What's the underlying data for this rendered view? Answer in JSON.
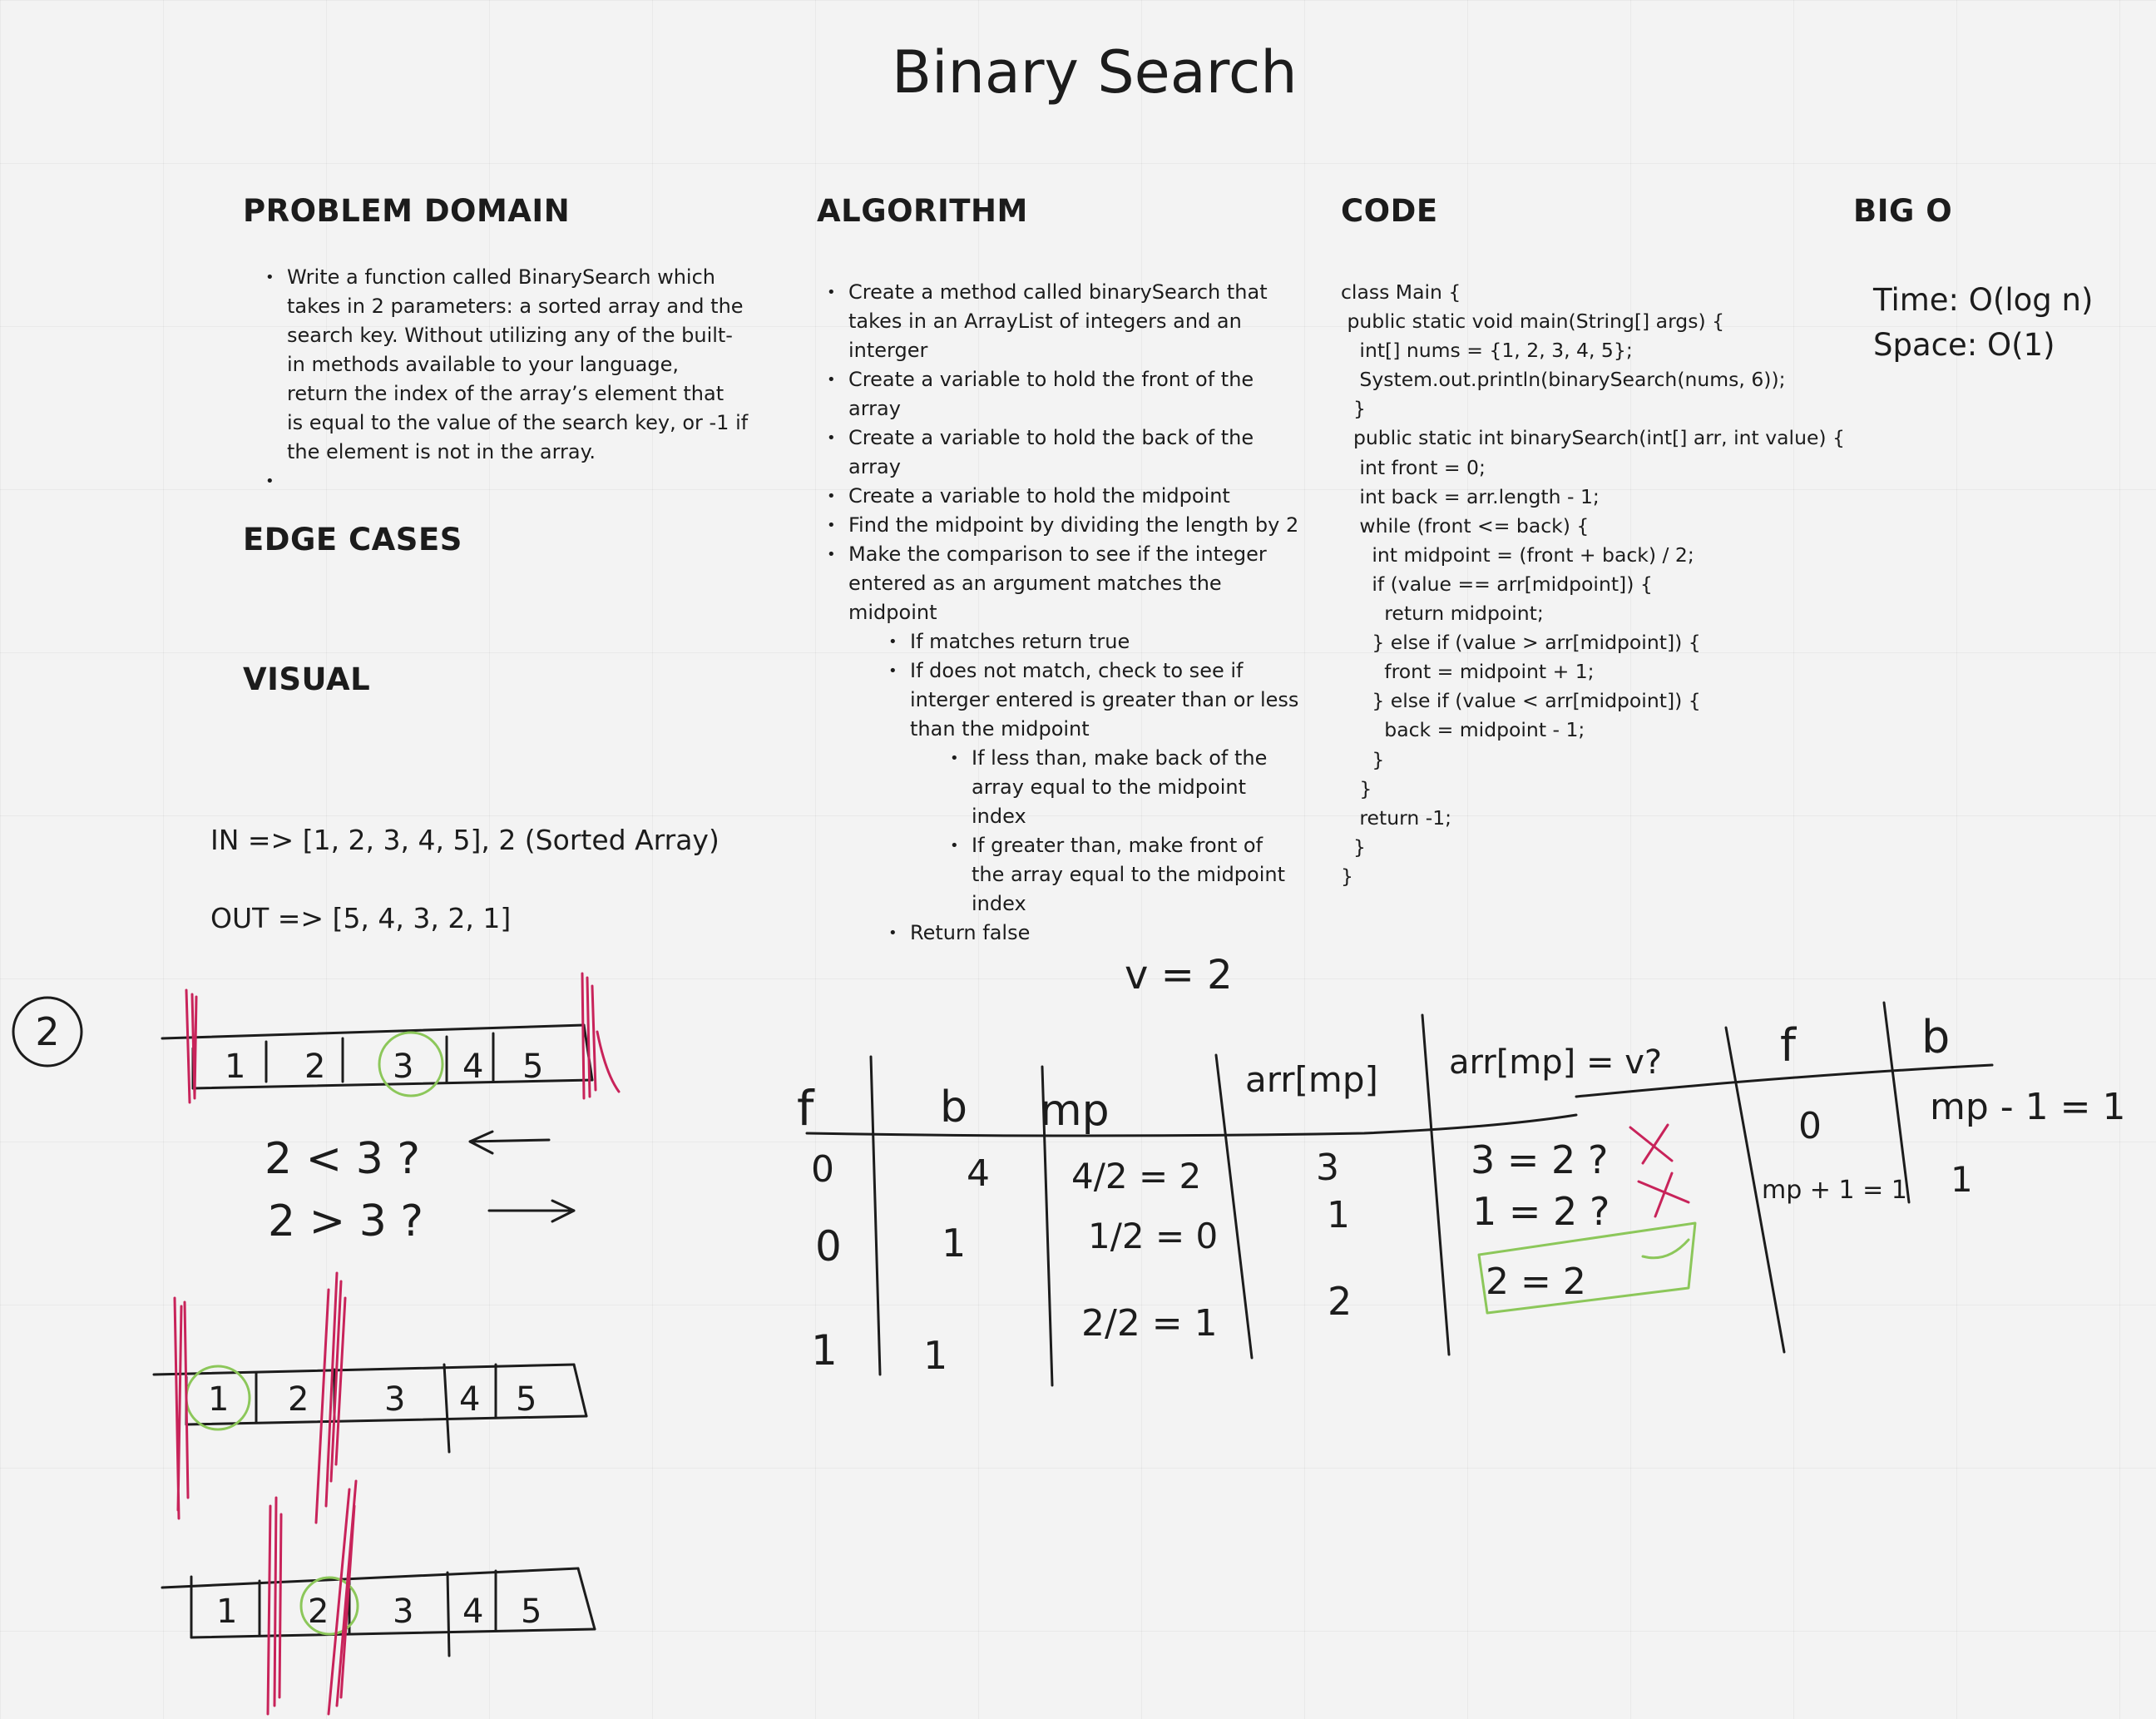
{
  "title": "Binary Search",
  "problem_domain": {
    "heading": "PROBLEM DOMAIN",
    "lines": [
      "Write a function called BinarySearch which",
      "takes in 2 parameters: a sorted array and the",
      "search key. Without utilizing any of the built-",
      "in methods available to your language,",
      "return the index of the array’s element that",
      "is equal to the value of the search key, or -1 if",
      "the element is not in the array."
    ],
    "empty_bullet": ""
  },
  "edge_cases": {
    "heading": "EDGE CASES"
  },
  "visual": {
    "heading": "VISUAL",
    "input": "IN => [1, 2, 3, 4, 5], 2 (Sorted Array)",
    "output": "OUT => [5, 4, 3, 2, 1]"
  },
  "algorithm": {
    "heading": "ALGORITHM",
    "items": [
      {
        "level": 0,
        "lines": [
          "Create a method called binarySearch that",
          "takes in an ArrayList of integers and an",
          "interger"
        ]
      },
      {
        "level": 0,
        "lines": [
          "Create a variable to hold the front of the",
          "array"
        ]
      },
      {
        "level": 0,
        "lines": [
          "Create a variable to hold the back of the",
          "array"
        ]
      },
      {
        "level": 0,
        "lines": [
          "Create a variable to hold the midpoint"
        ]
      },
      {
        "level": 0,
        "lines": [
          "Find the midpoint by dividing the length by 2"
        ]
      },
      {
        "level": 0,
        "lines": [
          "Make the comparison to see if the integer",
          "entered as an argument matches the",
          "midpoint"
        ]
      },
      {
        "level": 1,
        "lines": [
          "If matches return true"
        ]
      },
      {
        "level": 1,
        "lines": [
          "If does not match, check to see if",
          "interger entered is greater than or less",
          "than the midpoint"
        ]
      },
      {
        "level": 2,
        "lines": [
          "If less than, make back of the",
          "array equal to the midpoint",
          "index"
        ]
      },
      {
        "level": 2,
        "lines": [
          "If greater than, make front of",
          "the array equal to the midpoint",
          "index"
        ]
      },
      {
        "level": 1,
        "lines": [
          "Return false"
        ]
      }
    ]
  },
  "code": {
    "heading": "CODE",
    "lines": [
      "class Main {",
      " public static void main(String[] args) {",
      "   int[] nums = {1, 2, 3, 4, 5};",
      "   System.out.println(binarySearch(nums, 6));",
      "  }",
      "  public static int binarySearch(int[] arr, int value) {",
      "   int front = 0;",
      "   int back = arr.length - 1;",
      "   while (front <= back) {",
      "     int midpoint = (front + back) / 2;",
      "     if (value == arr[midpoint]) {",
      "       return midpoint;",
      "     } else if (value > arr[midpoint]) {",
      "       front = midpoint + 1;",
      "     } else if (value < arr[midpoint]) {",
      "       back = midpoint - 1;",
      "     }",
      "   }",
      "   return -1;",
      "  }",
      "}"
    ]
  },
  "big_o": {
    "heading": "BIG O",
    "time": "Time: O(log n)",
    "space": "Space: O(1)"
  },
  "sketch": {
    "step_label": "2",
    "arrays": [
      [
        "1",
        "2",
        "3",
        "4",
        "5"
      ],
      [
        "1",
        "2",
        "3",
        "4",
        "5"
      ],
      [
        "1",
        "2",
        "3",
        "4",
        "5"
      ]
    ],
    "comparisons": [
      "2 < 3 ?",
      "2 > 3 ?"
    ],
    "value_note": "v = 2",
    "table_headers": [
      "f",
      "b",
      "mp",
      "arr[mp]",
      "arr[mp] = v?",
      "f",
      "b"
    ],
    "table_rows": [
      [
        "0",
        "4",
        "4/2 = 2",
        "3",
        "3 = 2 ?",
        "0",
        "mp - 1 = 1"
      ],
      [
        "0",
        "1",
        "1/2 = 0",
        "1",
        "1 = 2 ?",
        "mp + 1 = 1",
        "1"
      ],
      [
        "1",
        "1",
        "2/2 = 1",
        "2",
        "2 = 2",
        "",
        ""
      ]
    ]
  },
  "colors": {
    "ink": "#1c1c1c",
    "red": "#c8235a",
    "green": "#8cc75a"
  }
}
